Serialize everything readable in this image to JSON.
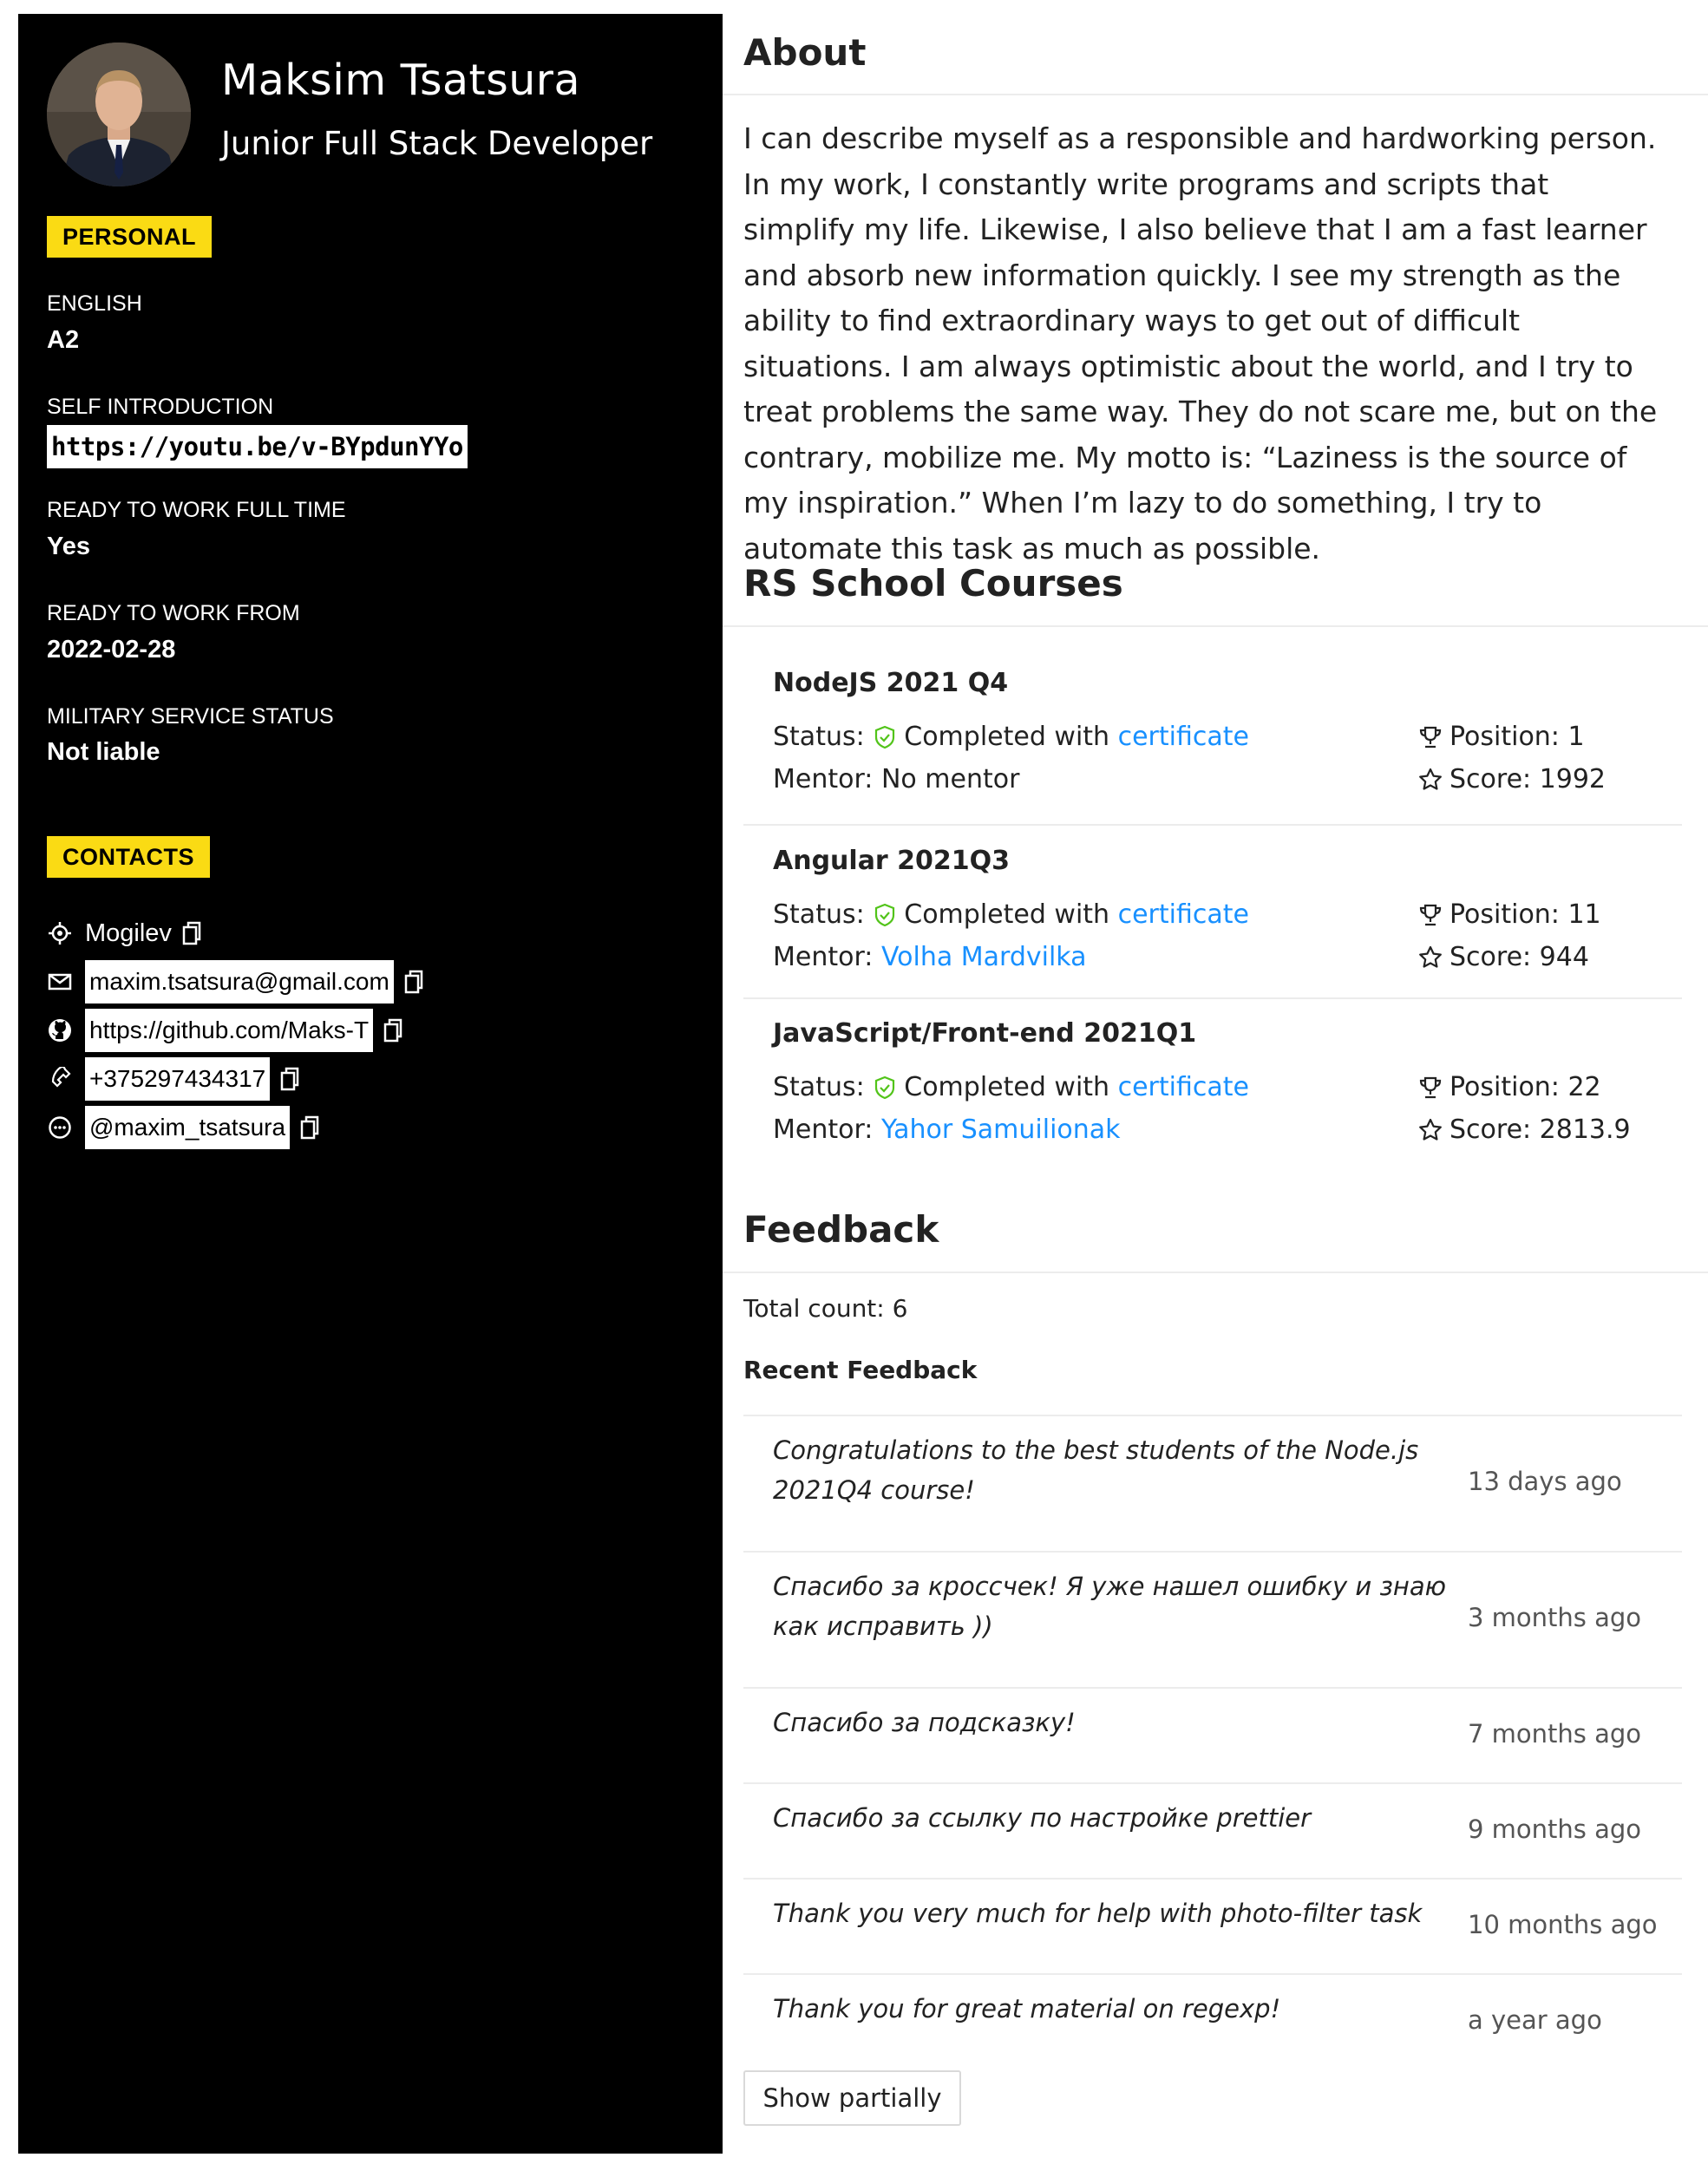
{
  "profile": {
    "name": "Maksim Tsatsura",
    "role": "Junior Full Stack Developer"
  },
  "personal": {
    "tag": "PERSONAL",
    "english_label": "ENGLISH",
    "english_value": "A2",
    "intro_label": "SELF INTRODUCTION",
    "intro_value": "https://youtu.be/v-BYpdunYYo",
    "fulltime_label": "READY TO WORK FULL TIME",
    "fulltime_value": "Yes",
    "from_label": "READY TO WORK FROM",
    "from_value": "2022-02-28",
    "military_label": "MILITARY SERVICE STATUS",
    "military_value": "Not liable"
  },
  "contacts": {
    "tag": "CONTACTS",
    "location": "Mogilev",
    "email": "maxim.tsatsura@gmail.com",
    "github": "https://github.com/Maks-T",
    "phone": "+375297434317",
    "telegram": "@maxim_tsatsura"
  },
  "about": {
    "title": "About",
    "text": "I can describe myself as a responsible and hardworking person. In my work, I constantly write programs and scripts that simplify my life. Likewise, I also believe that I am a fast learner and absorb new information quickly. I see my strength as the ability to find extraordinary ways to get out of difficult situations. I am always optimistic about the world, and I try to treat problems the same way. They do not scare me, but on the contrary, mobilize me. My motto is: “Laziness is the source of my inspiration.” When I’m lazy to do something, I try to automate this task as much as possible."
  },
  "courses": {
    "title": "RS School Courses",
    "status_label": "Status:",
    "completed_text": "Completed with",
    "certificate_link": "certificate",
    "mentor_label": "Mentor:",
    "items": [
      {
        "name": "NodeJS 2021 Q4",
        "mentor": "No mentor",
        "position": "Position: 1",
        "score": "Score: 1992"
      },
      {
        "name": "Angular 2021Q3",
        "mentor": "Volha Mardvilka",
        "position": "Position: 11",
        "score": "Score: 944"
      },
      {
        "name": "JavaScript/Front-end 2021Q1",
        "mentor": "Yahor Samuilionak",
        "position": "Position: 22",
        "score": "Score: 2813.9"
      }
    ]
  },
  "feedback": {
    "title": "Feedback",
    "total": "Total count: 6",
    "recent_label": "Recent Feedback",
    "items": [
      {
        "text": "Congratulations to the best students of the Node.js 2021Q4 course!",
        "time": "13 days ago"
      },
      {
        "text": "Спасибо за кроссчек! Я уже нашел ошибку и знаю как исправить ))",
        "time": "3 months ago"
      },
      {
        "text": "Спасибо за подсказку!",
        "time": "7 months ago"
      },
      {
        "text": "Спасибо за ссылку по настройке prettier",
        "time": "9 months ago"
      },
      {
        "text": "Thank you very much for help with photo-filter task",
        "time": "10 months ago"
      },
      {
        "text": "Thank you for great material on regexp!",
        "time": "a year ago"
      }
    ],
    "show_button": "Show partially"
  },
  "colors": {
    "sidebar_bg": "#000000",
    "tag_bg": "#fadb14",
    "link": "#1890ff",
    "check": "#52c41a"
  }
}
